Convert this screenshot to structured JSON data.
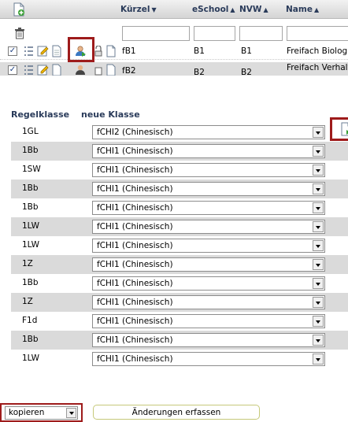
{
  "top_grid": {
    "columns": {
      "kuerzel": "Kürzel",
      "eschool": "eSchool",
      "nvw": "NVW",
      "name": "Name"
    },
    "sort_arrows": {
      "kuerzel": "▼",
      "eschool": "▲",
      "nvw": "▲",
      "name": "▲"
    },
    "rows": [
      {
        "kuerzel": "fB1",
        "eschool": "B1",
        "nvw": "B1",
        "name": "Freifach Biologie"
      },
      {
        "kuerzel": "fB2",
        "eschool": "B2",
        "nvw": "B2",
        "name": "Freifach Verhalt"
      }
    ]
  },
  "lower_table": {
    "headers": {
      "regelklasse": "Regelklasse",
      "neue_klasse": "neue Klasse"
    },
    "rows": [
      {
        "regelklasse": "1GL",
        "neue_klasse": "fCHI2 (Chinesisch)"
      },
      {
        "regelklasse": "1Bb",
        "neue_klasse": "fCHI1 (Chinesisch)"
      },
      {
        "regelklasse": "1SW",
        "neue_klasse": "fCHI1 (Chinesisch)"
      },
      {
        "regelklasse": "1Bb",
        "neue_klasse": "fCHI1 (Chinesisch)"
      },
      {
        "regelklasse": "1Bb",
        "neue_klasse": "fCHI1 (Chinesisch)"
      },
      {
        "regelklasse": "1LW",
        "neue_klasse": "fCHI1 (Chinesisch)"
      },
      {
        "regelklasse": "1LW",
        "neue_klasse": "fCHI1 (Chinesisch)"
      },
      {
        "regelklasse": "1Z",
        "neue_klasse": "fCHI1 (Chinesisch)"
      },
      {
        "regelklasse": "1Bb",
        "neue_klasse": "fCHI1 (Chinesisch)"
      },
      {
        "regelklasse": "1Z",
        "neue_klasse": "fCHI1 (Chinesisch)"
      },
      {
        "regelklasse": "F1d",
        "neue_klasse": "fCHI1 (Chinesisch)"
      },
      {
        "regelklasse": "1Bb",
        "neue_klasse": "fCHI1 (Chinesisch)"
      },
      {
        "regelklasse": "1LW",
        "neue_klasse": "fCHI1 (Chinesisch)"
      }
    ]
  },
  "footer": {
    "action_value": "kopieren",
    "submit_label": "Änderungen erfassen"
  },
  "colors": {
    "highlight": "#9e1b1b",
    "row_alt": "#dadada",
    "header_text": "#2a3b5a"
  },
  "icons": {
    "add_record": "add-document-icon",
    "filter_clear": "trash-icon",
    "copy_action": "copy-action-icon"
  }
}
